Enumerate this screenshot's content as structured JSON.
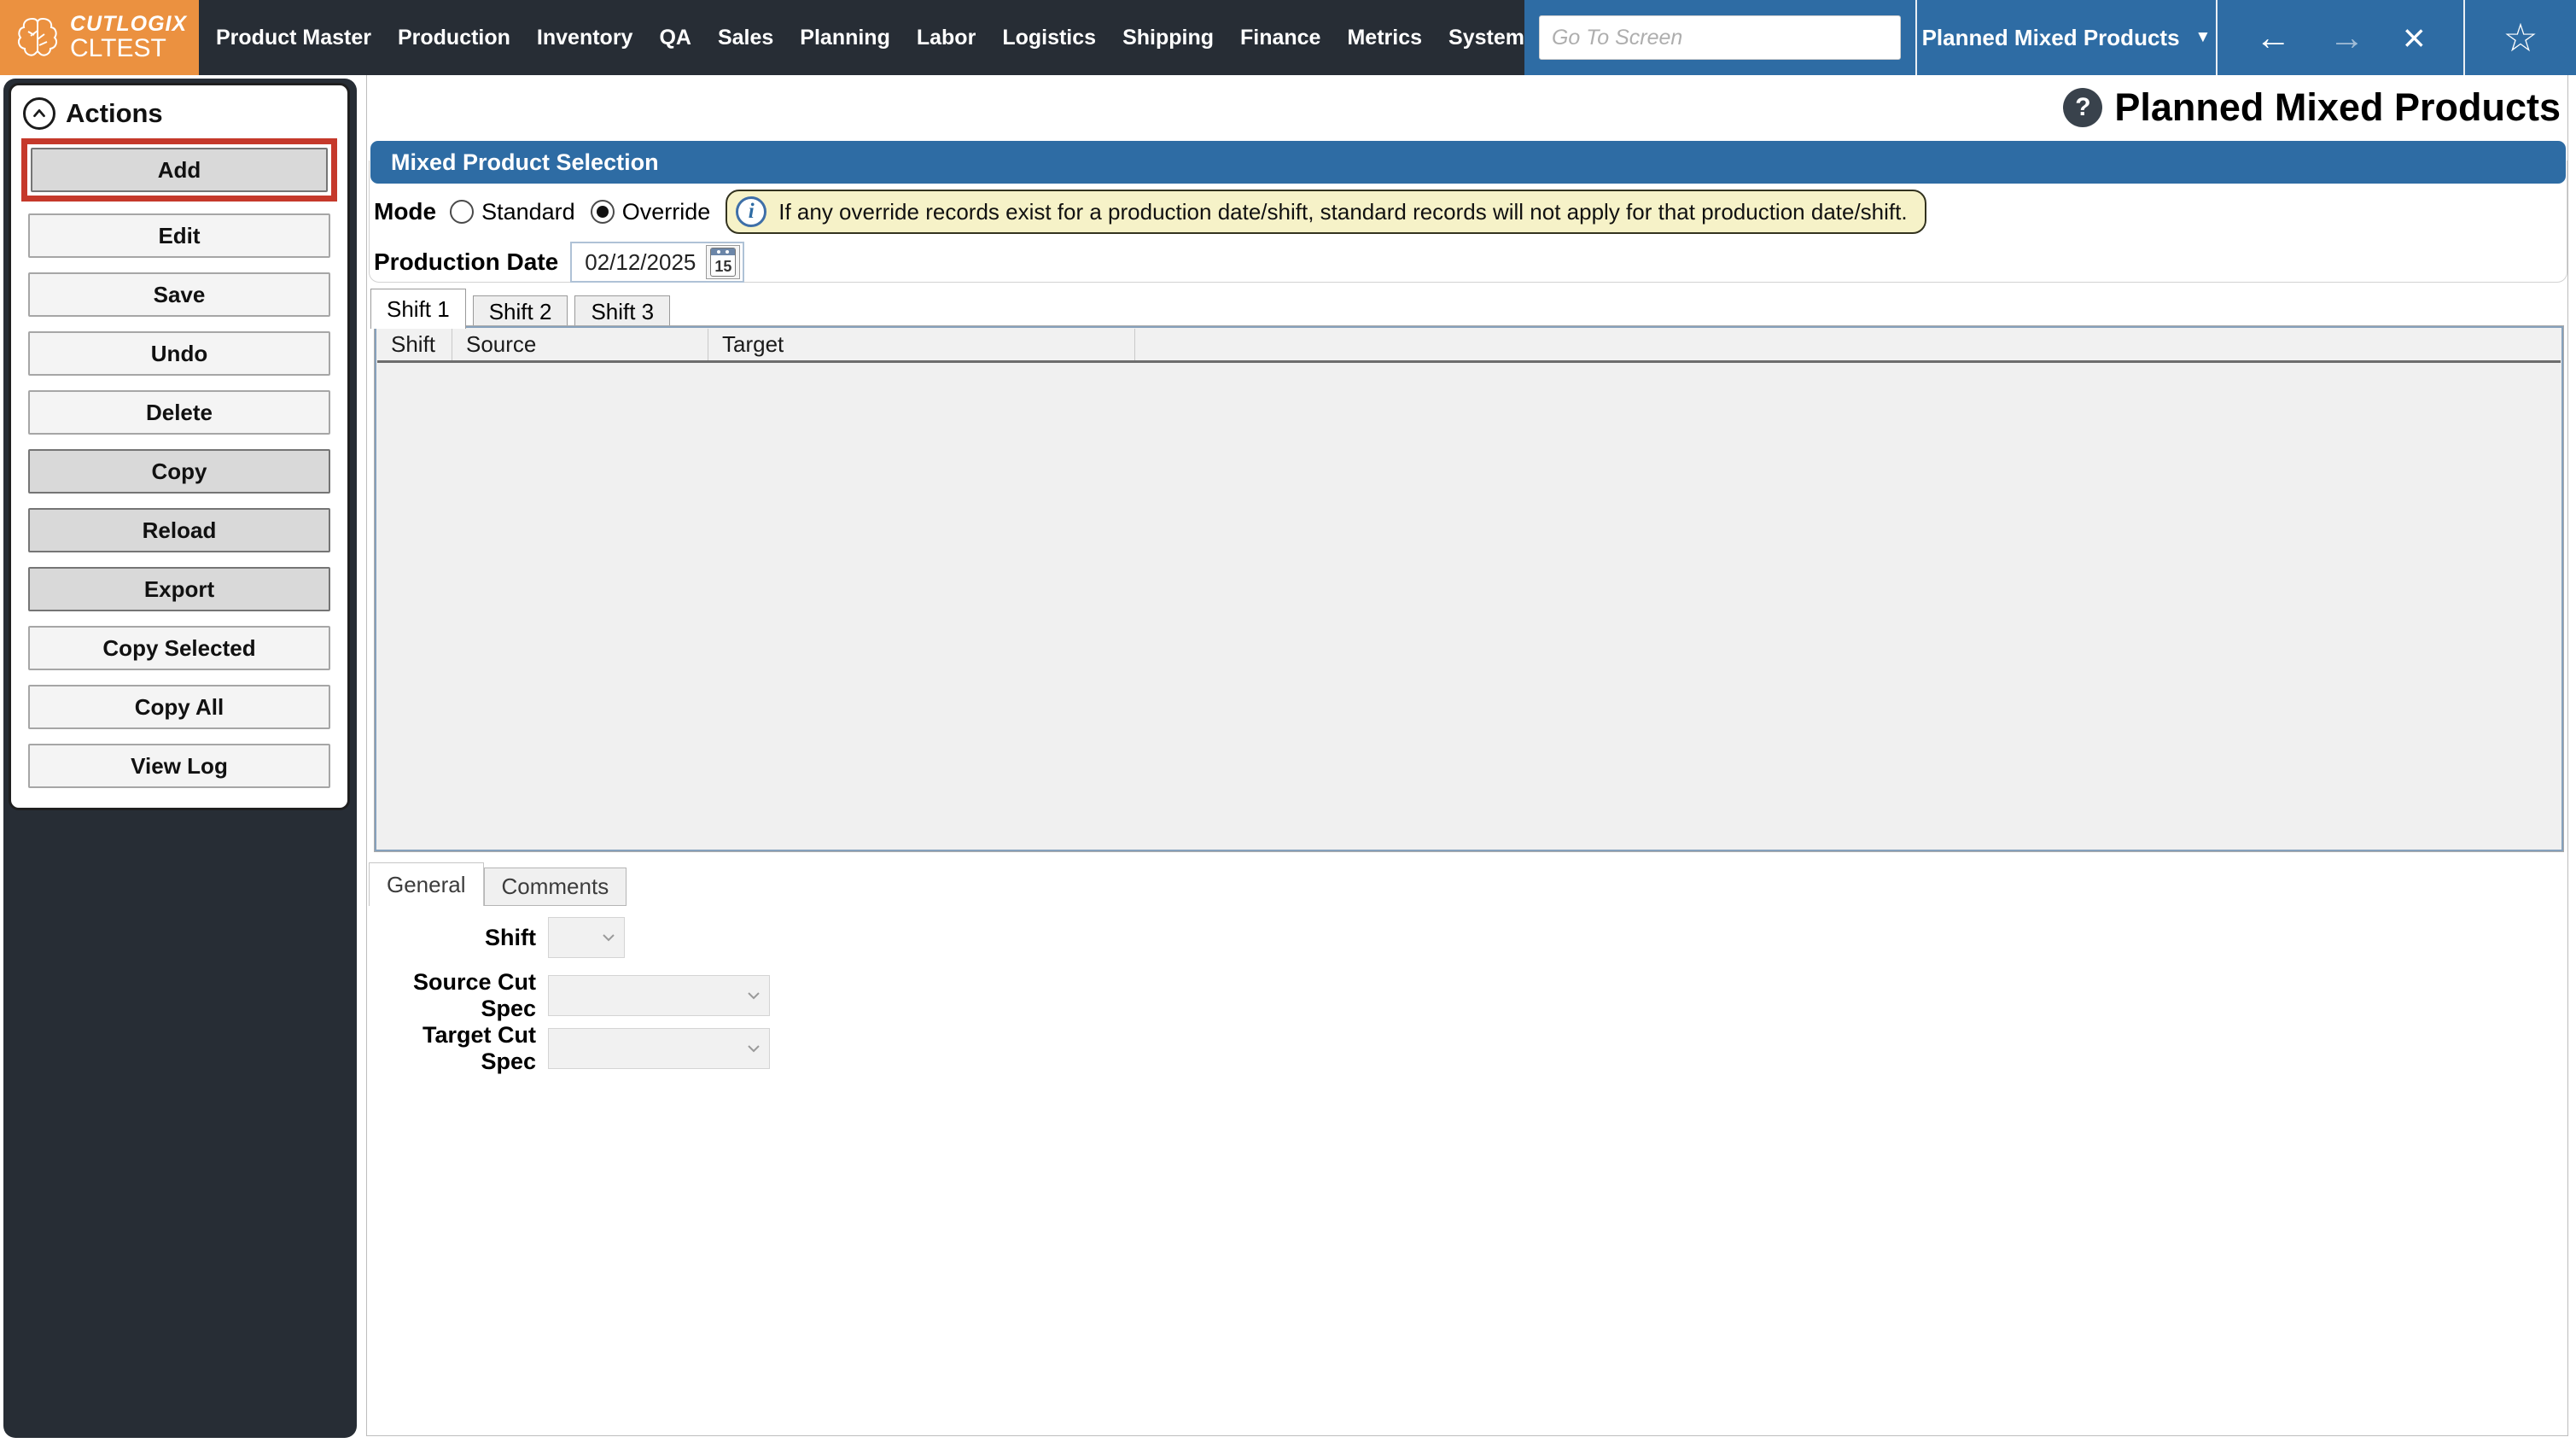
{
  "brand": {
    "name": "CUTLOGIX",
    "environment": "CLTEST"
  },
  "nav": {
    "items": [
      "Product Master",
      "Production",
      "Inventory",
      "QA",
      "Sales",
      "Planning",
      "Labor",
      "Logistics",
      "Shipping",
      "Finance",
      "Metrics",
      "System"
    ]
  },
  "quick_access": {
    "go_to_screen_placeholder": "Go To Screen",
    "screen_selector_value": "Planned Mixed Products",
    "dropdown_arrow": "▼",
    "back_glyph": "←",
    "forward_glyph": "→",
    "close_glyph": "×",
    "favorite_glyph": "☆"
  },
  "page": {
    "title": "Planned Mixed Products",
    "help_glyph": "?"
  },
  "actions": {
    "title": "Actions",
    "buttons": [
      {
        "label": "Add"
      },
      {
        "label": "Edit"
      },
      {
        "label": "Save"
      },
      {
        "label": "Undo"
      },
      {
        "label": "Delete"
      },
      {
        "label": "Copy"
      },
      {
        "label": "Reload"
      },
      {
        "label": "Export"
      },
      {
        "label": "Copy Selected"
      },
      {
        "label": "Copy All"
      },
      {
        "label": "View Log"
      }
    ]
  },
  "selection": {
    "header": "Mixed Product Selection",
    "mode_label": "Mode",
    "mode_options": [
      {
        "label": "Standard",
        "selected": false
      },
      {
        "label": "Override",
        "selected": true
      }
    ],
    "info_icon_glyph": "i",
    "info_message": "If any override records exist for a production date/shift, standard records will not apply for that production date/shift.",
    "production_date_label": "Production Date",
    "production_date_value": "02/12/2025",
    "calendar_day": "15",
    "shift_tabs": [
      {
        "label": "Shift 1",
        "active": true
      },
      {
        "label": "Shift 2",
        "active": false
      },
      {
        "label": "Shift 3",
        "active": false
      }
    ],
    "table": {
      "columns": [
        "Shift",
        "Source",
        "Target"
      ],
      "rows": []
    }
  },
  "detail": {
    "tabs": [
      {
        "label": "General",
        "active": true
      },
      {
        "label": "Comments",
        "active": false
      }
    ],
    "fields": [
      {
        "label": "Shift",
        "value": ""
      },
      {
        "label": "Source Cut Spec",
        "value": ""
      },
      {
        "label": "Target Cut Spec",
        "value": ""
      }
    ]
  },
  "colors": {
    "topbar_dark": "#272D35",
    "brand_orange": "#EB9140",
    "accent_blue": "#2E6CA4",
    "highlight_red": "#C5392B",
    "info_yellow": "#F6F2C8",
    "grid_border_blue": "#86A1BC"
  }
}
